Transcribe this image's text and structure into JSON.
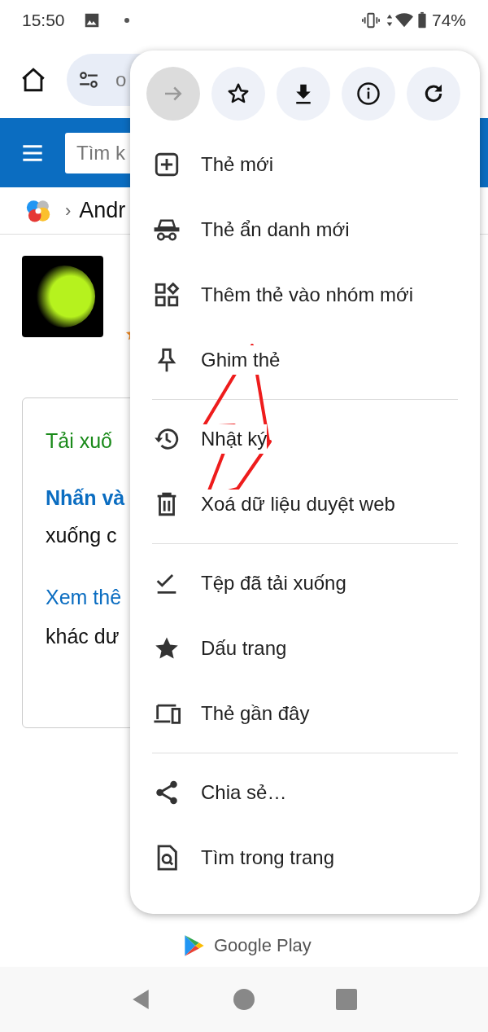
{
  "status_bar": {
    "time": "15:50",
    "battery": "74%"
  },
  "toolbar": {
    "url": "o"
  },
  "site_header": {
    "search_placeholder": "Tìm k"
  },
  "breadcrumb": {
    "separator": "›",
    "item": "Andr"
  },
  "card": {
    "heading": "Tải xuố",
    "bold_link": "Nhấn và",
    "text_1": "xuống c",
    "link": "Xem thê",
    "text_2": "khác dư"
  },
  "footer": {
    "store": "Google Play"
  },
  "menu": {
    "actions": [
      {
        "disabled": true
      },
      {
        "disabled": false
      },
      {
        "disabled": false
      },
      {
        "disabled": false
      },
      {
        "disabled": false
      }
    ],
    "sections": [
      [
        "Thẻ mới",
        "Thẻ ẩn danh mới",
        "Thêm thẻ vào nhóm mới",
        "Ghim thẻ"
      ],
      [
        "Nhật ký",
        "Xoá dữ liệu duyệt web"
      ],
      [
        "Tệp đã tải xuống",
        "Dấu trang",
        "Thẻ gần đây"
      ],
      [
        "Chia sẻ…",
        "Tìm trong trang"
      ]
    ]
  }
}
